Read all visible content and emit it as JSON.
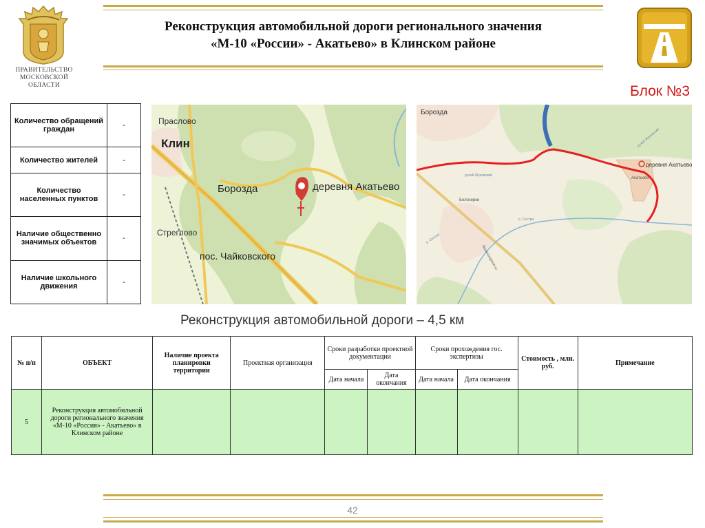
{
  "header": {
    "org_name": "ПРАВИТЕЛЬСТВО\nМОСКОВСКОЙ\nОБЛАСТИ",
    "title_line1": "Реконструкция автомобильной дороги регионального значения",
    "title_line2": "«М-10 «России» - Акатьево» в Клинском районе",
    "block_label": "Блок №3"
  },
  "info_table": [
    {
      "label": "Количество обращений граждан",
      "value": "-"
    },
    {
      "label": "Количество жителей",
      "value": "-"
    },
    {
      "label": "Количество населенных пунктов",
      "value": "-"
    },
    {
      "label": "Наличие общественно значимых объектов",
      "value": "-"
    },
    {
      "label": "Наличие школьного движения",
      "value": "-"
    }
  ],
  "map1": {
    "labels": {
      "praslovo": "Праслово",
      "klin": "Клин",
      "borozda": "Борозда",
      "village": "деревня Акатьево",
      "streglovo": "Стреглово",
      "chaikovsky": "пос. Чайковского"
    }
  },
  "map2": {
    "labels": {
      "borozda": "Борозда",
      "village": "деревня Акатьево",
      "village2": "Акатьево",
      "belozerki": "Белозерки",
      "stream1": "ручей Жуковский",
      "river": "р. Сестра",
      "river2": "р. Сестра",
      "highway": "Ленинградское ш.",
      "stream2": "ручей Жуковский"
    },
    "route_color": "#e61e1e"
  },
  "subtitle": "Реконструкция автомобильной дороги – 4,5 км",
  "main_table": {
    "headers": {
      "num": "№ п/п",
      "object": "ОБЪЕКТ",
      "plan": "Наличие проекта планировки территории",
      "org": "Проектная организация",
      "dev_terms": "Сроки разработки проектной документации",
      "exp_terms": "Сроки прохождения гос. экспертизы",
      "cost": "Стоимость , млн. руб.",
      "note": "Примечание",
      "start1": "Дата начала",
      "end1": "Дата окончания",
      "start2": "Дата начала",
      "end2": "Дата окончания"
    },
    "rows": [
      {
        "num": "5",
        "object": "Реконструкция автомобильной дороги регионального значения «М-10 «Россия» - Акатьево» в Клинском районе",
        "plan": "",
        "org": "",
        "start1": "",
        "end1": "",
        "start2": "",
        "end2": "",
        "cost": "",
        "note": ""
      }
    ]
  },
  "page_number": "42",
  "colors": {
    "accent_gold": "#c9a84a",
    "block_red": "#d11a1a",
    "row_green": "#ccf4c2"
  }
}
